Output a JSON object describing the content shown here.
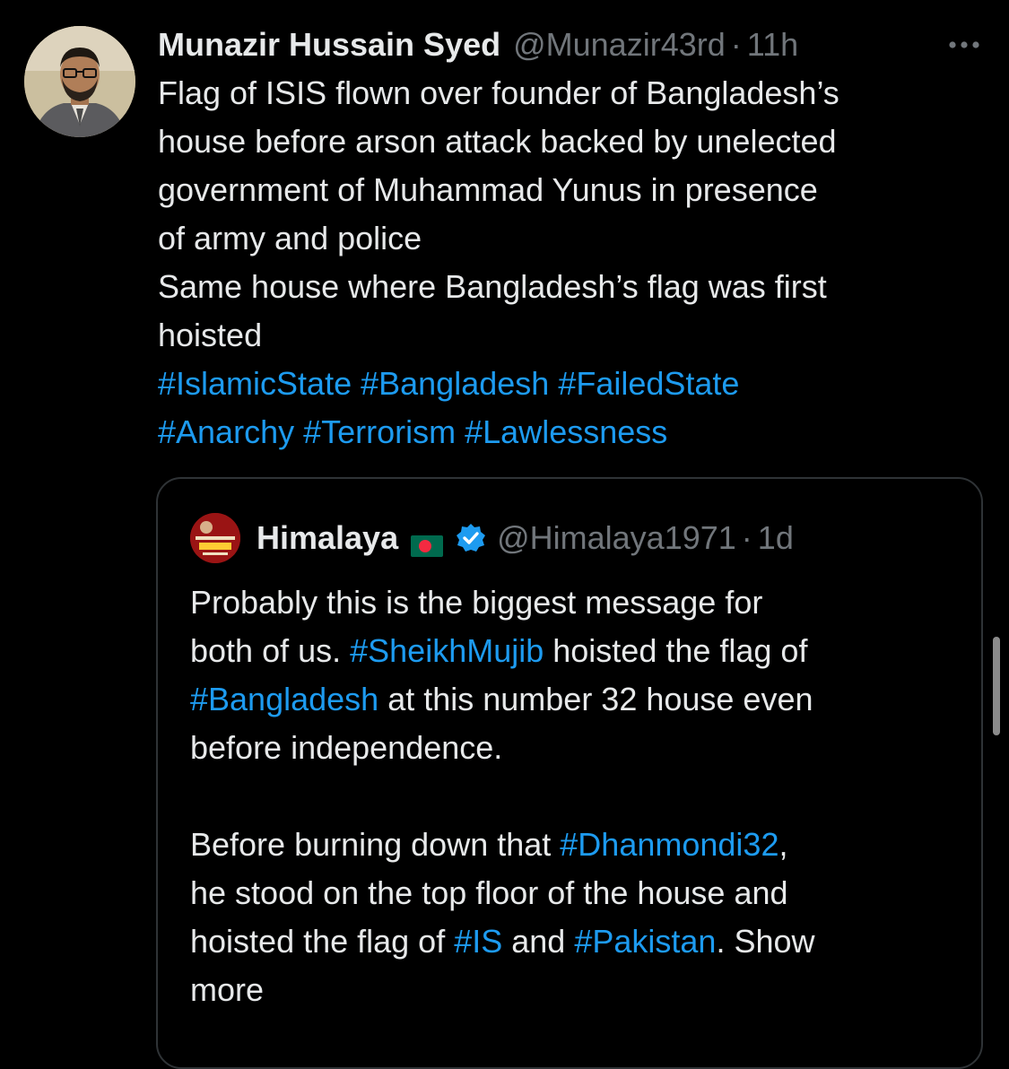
{
  "tweet": {
    "author_name": "Munazir Hussain Syed",
    "author_handle": "@Munazir43rd",
    "separator": "·",
    "time": "11h",
    "more_icon": "ellipsis-icon",
    "text_lines": [
      "Flag of ISIS flown over founder of Bangladesh’s",
      "house before arson attack backed by unelected",
      "government of Muhammad Yunus in presence",
      "of army and police",
      "Same house where Bangladesh’s flag was first",
      "hoisted"
    ],
    "hashtag_lines": [
      [
        "#IslamicState",
        "#Bangladesh",
        "#FailedState"
      ],
      [
        "#Anarchy",
        "#Terrorism",
        "#Lawlessness"
      ]
    ]
  },
  "quoted": {
    "author_name": "Himalaya",
    "flag_icon": "bangladesh-flag-icon",
    "verified_icon": "verified-badge-icon",
    "author_handle": "@Himalaya1971",
    "separator": "·",
    "time": "1d",
    "paragraph1": [
      {
        "parts": [
          {
            "t": "Probably this is the biggest message for"
          }
        ]
      },
      {
        "parts": [
          {
            "t": "both of us. "
          },
          {
            "t": "#SheikhMujib",
            "tag": true
          },
          {
            "t": " hoisted the flag of"
          }
        ]
      },
      {
        "parts": [
          {
            "t": "#Bangladesh",
            "tag": true
          },
          {
            "t": " at this number 32 house even"
          }
        ]
      },
      {
        "parts": [
          {
            "t": "before independence."
          }
        ]
      }
    ],
    "paragraph2": [
      {
        "parts": [
          {
            "t": "Before burning down that "
          },
          {
            "t": "#Dhanmondi32",
            "tag": true
          },
          {
            "t": ","
          }
        ]
      },
      {
        "parts": [
          {
            "t": "he stood on the top floor of the house and"
          }
        ]
      },
      {
        "parts": [
          {
            "t": "hoisted the flag of "
          },
          {
            "t": "#IS",
            "tag": true
          },
          {
            "t": " and "
          },
          {
            "t": "#Pakistan",
            "tag": true
          },
          {
            "t": ". Show"
          }
        ]
      },
      {
        "parts": [
          {
            "t": "more"
          }
        ]
      }
    ]
  },
  "colors": {
    "background": "#000000",
    "text": "#e7e9ea",
    "muted": "#71767b",
    "link": "#1d9bf0",
    "border": "#2f3336"
  }
}
